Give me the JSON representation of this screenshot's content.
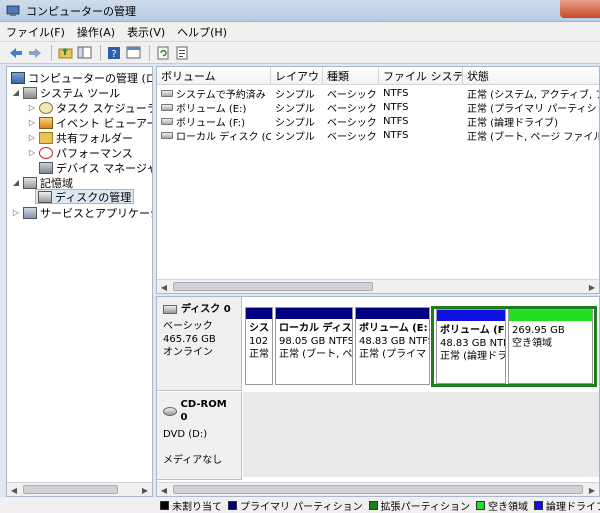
{
  "window": {
    "title": "コンピューターの管理"
  },
  "menu": [
    "ファイル(F)",
    "操作(A)",
    "表示(V)",
    "ヘルプ(H)"
  ],
  "tree": {
    "root": "コンピューターの管理 (ローカル)",
    "system_tools": "システム ツール",
    "task_scheduler": "タスク スケジューラ",
    "event_viewer": "イベント ビューアー",
    "shared_folders": "共有フォルダー",
    "performance": "パフォーマンス",
    "device_manager": "デバイス マネージャー",
    "storage": "記憶域",
    "disk_management": "ディスクの管理",
    "services": "サービスとアプリケーション"
  },
  "volumes": {
    "headers": [
      "ボリューム",
      "レイアウト",
      "種類",
      "ファイル システム",
      "状態"
    ],
    "rows": [
      [
        "システムで予約済み",
        "シンプル",
        "ベーシック",
        "NTFS",
        "正常 (システム, アクティブ, プライマリ"
      ],
      [
        "ボリューム (E:)",
        "シンプル",
        "ベーシック",
        "NTFS",
        "正常 (プライマリ パーティション)"
      ],
      [
        "ボリューム (F:)",
        "シンプル",
        "ベーシック",
        "NTFS",
        "正常 (論理ドライブ)"
      ],
      [
        "ローカル ディスク (C:)",
        "シンプル",
        "ベーシック",
        "NTFS",
        "正常 (ブート, ページ ファイル, クラッシュ"
      ]
    ]
  },
  "disk0": {
    "name": "ディスク 0",
    "type": "ベーシック",
    "size": "465.76 GB",
    "status": "オンライン",
    "partitions": [
      {
        "name": "シス",
        "size": "102 I",
        "status": "正常",
        "bar": "#000080"
      },
      {
        "name": "ローカル ディスク",
        "size": "98.05 GB NTFS",
        "status": "正常 (ブート, ペ",
        "bar": "#000080"
      },
      {
        "name": "ボリューム (E:",
        "size": "48.83 GB NTFS",
        "status": "正常 (プライマ",
        "bar": "#000080"
      },
      {
        "name": "ボリューム (F",
        "size": "48.83 GB NTF",
        "status": "正常 (論理ドラ",
        "bar": "#1010e0"
      },
      {
        "name": "",
        "size": "269.95 GB",
        "status": "空き領域",
        "bar": "#22dd22"
      }
    ]
  },
  "cdrom": {
    "name": "CD-ROM 0",
    "drive": "DVD (D:)",
    "status": "メディアなし"
  },
  "legend": [
    {
      "label": "未割り当て",
      "color": "#000000"
    },
    {
      "label": "プライマリ パーティション",
      "color": "#000080"
    },
    {
      "label": "拡張パーティション",
      "color": "#1f7d1f"
    },
    {
      "label": "空き領域",
      "color": "#22dd22"
    },
    {
      "label": "論理ドライブ",
      "color": "#1010e0"
    }
  ]
}
